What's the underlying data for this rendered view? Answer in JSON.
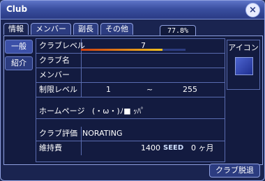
{
  "window": {
    "title": "Club",
    "close_glyph": "×"
  },
  "tabs": [
    {
      "label": "情報"
    },
    {
      "label": "メンバー"
    },
    {
      "label": "副長"
    },
    {
      "label": "その他"
    }
  ],
  "percent_badge": "77.8%",
  "side_nav": [
    {
      "label": "一般"
    },
    {
      "label": "紹介"
    }
  ],
  "club": {
    "level_label": "クラブレベル",
    "level_value": "7",
    "level_progress": 0.778,
    "name_label": "クラブ名",
    "name_value": "",
    "members_label": "メンバー",
    "members_value": "",
    "limit_label": "制限レベル",
    "limit_min": "1",
    "limit_sep": "~",
    "limit_max": "255",
    "homepage_label": "ホームページ",
    "homepage_value": "(・ω・)ﾉ■ ｯﾊﾟ",
    "rating_label": "クラブ評価",
    "rating_value": "NORATING",
    "upkeep_label": "維持費",
    "upkeep_value": "1400",
    "upkeep_currency": "SEED",
    "upkeep_months": "0 ヶ月"
  },
  "icon_panel": {
    "label": "アイコン"
  },
  "leave_button": "クラブ脱退"
}
